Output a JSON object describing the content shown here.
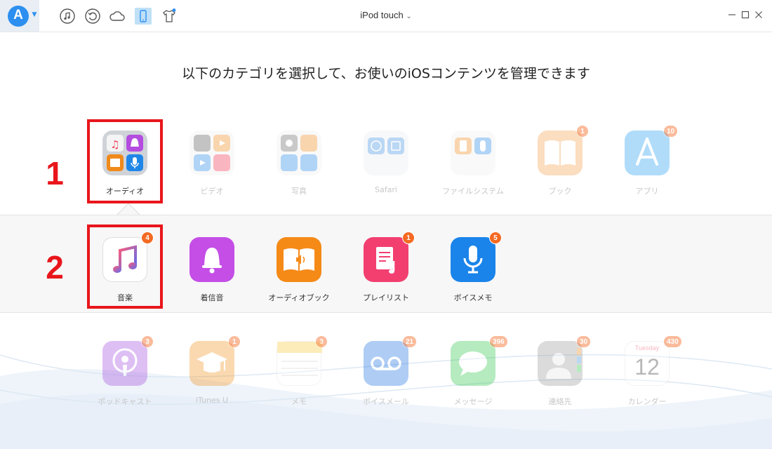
{
  "app": {
    "device_title": "iPod touch",
    "toolbar_icons": [
      "music-note-icon",
      "restore-icon",
      "cloud-icon",
      "device-icon",
      "tshirt-icon"
    ],
    "accent": "#2d8ff0"
  },
  "heading": "以下のカテゴリを選択して、お使いのiOSコンテンツを管理できます",
  "categories": [
    {
      "label": "オーディオ",
      "active": true
    },
    {
      "label": "ビデオ",
      "active": false
    },
    {
      "label": "写真",
      "active": false
    },
    {
      "label": "Safari",
      "active": false
    },
    {
      "label": "ファイルシステム",
      "active": false
    },
    {
      "label": "ブック",
      "badge": "1",
      "active": false
    },
    {
      "label": "アプリ",
      "badge": "10",
      "active": false
    }
  ],
  "subcategories": [
    {
      "label": "音楽",
      "badge": "4"
    },
    {
      "label": "着信音"
    },
    {
      "label": "オーディオブック"
    },
    {
      "label": "プレイリスト",
      "badge": "1"
    },
    {
      "label": "ボイスメモ",
      "badge": "5"
    }
  ],
  "others": [
    {
      "label": "ポッドキャスト",
      "badge": "3"
    },
    {
      "label": "iTunes U",
      "badge": "1"
    },
    {
      "label": "メモ",
      "badge": "3"
    },
    {
      "label": "ボイスメール",
      "badge": "21"
    },
    {
      "label": "メッセージ",
      "badge": "396"
    },
    {
      "label": "連絡先",
      "badge": "30"
    },
    {
      "label": "カレンダー",
      "badge": "430",
      "calendar_day": "Tuesday",
      "calendar_date": "12"
    }
  ],
  "annotations": {
    "step1": "1",
    "step2": "2",
    "color": "#e8161c"
  }
}
